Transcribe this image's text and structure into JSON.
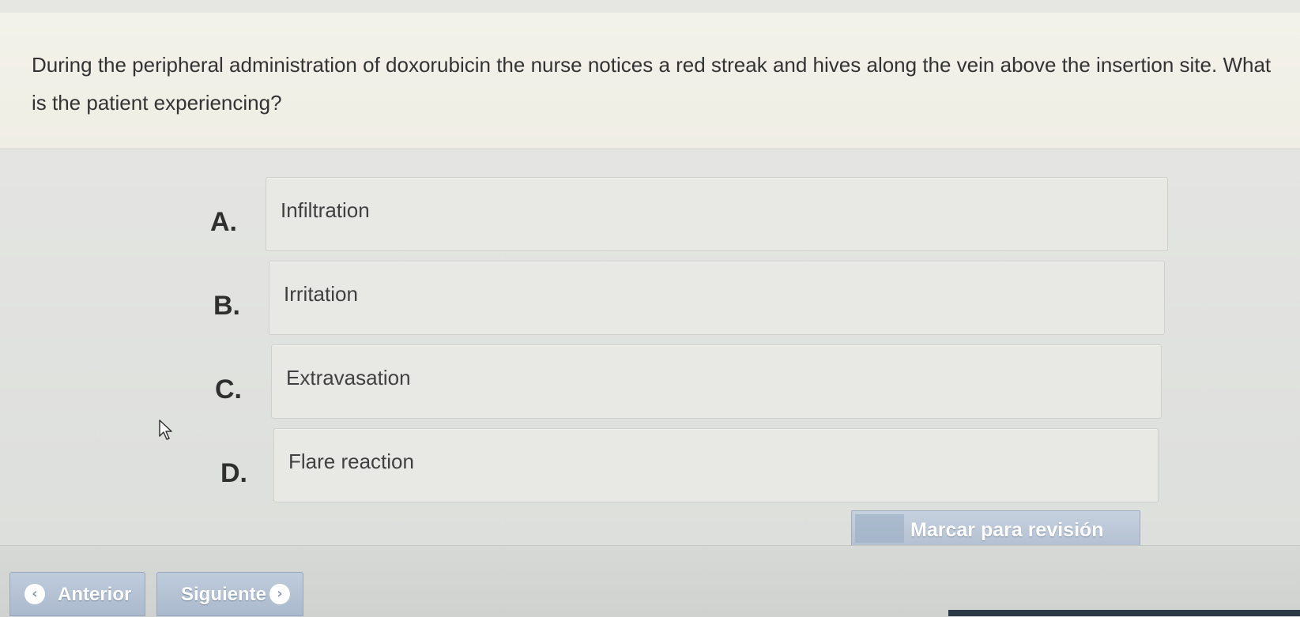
{
  "question": {
    "text": "During the peripheral administration of doxorubicin the nurse notices a red streak and hives along the vein above the insertion site. What is the patient experiencing?"
  },
  "options": [
    {
      "letter": "A.",
      "text": "Infiltration"
    },
    {
      "letter": "B.",
      "text": "Irritation"
    },
    {
      "letter": "C.",
      "text": "Extravasation"
    },
    {
      "letter": "D.",
      "text": "Flare reaction"
    }
  ],
  "mark_review": {
    "label": "Marcar para revisión"
  },
  "navigation": {
    "previous_label": "Anterior",
    "next_label": "Siguiente",
    "previous_icon": "chevron-left-icon",
    "next_icon": "chevron-right-icon"
  },
  "colors": {
    "question_bg": "#f3f2ea",
    "answers_bg": "#e4e5e2",
    "button_blue": "#b4c1d2",
    "text": "#333333"
  }
}
